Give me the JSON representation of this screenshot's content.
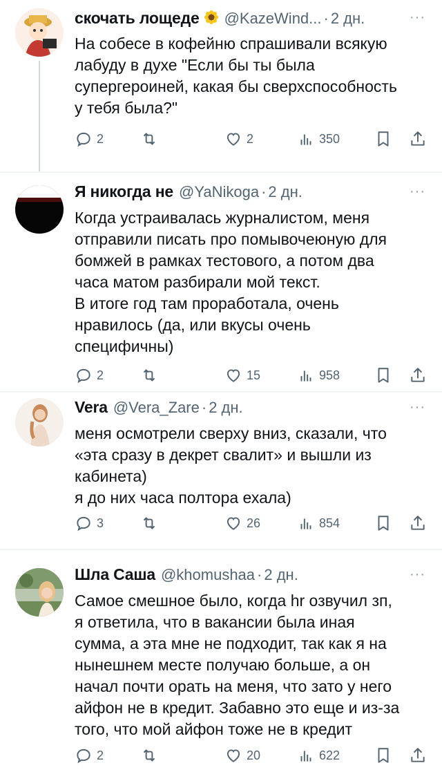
{
  "tweets": [
    {
      "name": "скочать лощеде",
      "has_emoji": true,
      "handle": "@KazeWind...",
      "dot": "·",
      "time": "2 дн.",
      "more": "···",
      "lines": [
        "На собесе в кофейню спрашивали всякую",
        "лабуду в духе \"Если бы ты была",
        "супергероиней, какая бы сверхспособность",
        "у тебя была?\""
      ],
      "replies": "2",
      "retweets": "",
      "likes": "2",
      "views": "350"
    },
    {
      "name": "Я никогда не",
      "has_emoji": false,
      "handle": "@YaNikoga",
      "dot": "·",
      "time": "2 дн.",
      "more": "···",
      "lines": [
        "Когда устраивалась журналистом, меня",
        "отправили писать про помывочеюную для",
        "бомжей в рамках тестового, а потом два",
        "часа матом разбирали мой текст.",
        "В итоге год там проработала, очень",
        "нравилось (да, или вкусы очень",
        "специфичны)"
      ],
      "replies": "2",
      "retweets": "",
      "likes": "15",
      "views": "958"
    },
    {
      "name": "Vera",
      "has_emoji": false,
      "handle": "@Vera_Zare",
      "dot": "·",
      "time": "2 дн.",
      "more": "···",
      "lines": [
        "меня осмотрели сверху вниз, сказали, что",
        "«эта сразу в декрет свалит» и вышли из",
        "кабинета)",
        "я до них часа полтора ехала)"
      ],
      "replies": "3",
      "retweets": "",
      "likes": "26",
      "views": "854"
    },
    {
      "name": "Шла Саша",
      "has_emoji": false,
      "handle": "@khomushaa",
      "dot": "·",
      "time": "2 дн.",
      "more": "···",
      "lines": [
        "Самое смешное было, когда hr озвучил зп,",
        "я ответила, что в вакансии была иная",
        "сумма, а эта мне не подходит, так как я на",
        "нынешнем месте получаю больше, а он",
        "начал почти орать на меня, что зато у него",
        "айфон не в кредит. Забавно это еще и из-за",
        "того, что мой айфон тоже не в кредит"
      ],
      "replies": "2",
      "retweets": "",
      "likes": "20",
      "views": "622"
    }
  ],
  "icons": {
    "reply": "reply-icon",
    "retweet": "retweet-icon",
    "like": "heart-icon",
    "views": "views-icon",
    "bookmark": "bookmark-icon",
    "share": "share-icon"
  }
}
